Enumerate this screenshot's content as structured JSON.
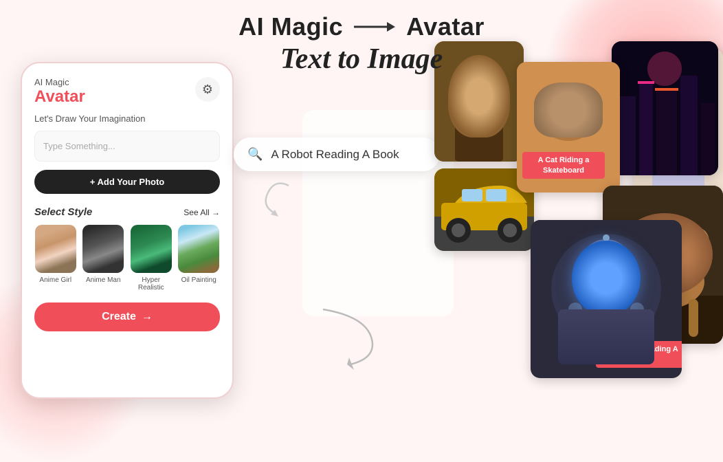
{
  "header": {
    "title_part1": "AI Magic",
    "arrow": "→",
    "title_part2": "Avatar",
    "subtitle": "Text to Image"
  },
  "phone": {
    "app_label": "AI Magic",
    "app_title": "Avatar",
    "subtitle": "Let's Draw Your Imagination",
    "input_placeholder": "Type Something...",
    "add_photo_label": "+ Add Your Photo",
    "select_style_label": "Select",
    "select_style_bold": "Style",
    "see_all_label": "See All →",
    "styles": [
      {
        "label": "Anime Girl"
      },
      {
        "label": "Anime Man"
      },
      {
        "label": "Hyper Realistic"
      },
      {
        "label": "Oil Painting"
      }
    ],
    "create_label": "Create",
    "create_arrow": "→"
  },
  "search": {
    "text": "A Robot Reading A Book",
    "placeholder": "A Robot Reading A Book"
  },
  "gallery": {
    "label_cat": "A Cat Riding a Skateboard",
    "label_robot": "A Robot Reading A Book"
  }
}
